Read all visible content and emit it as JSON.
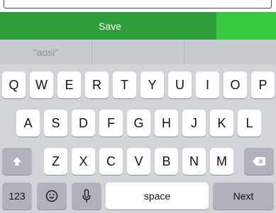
{
  "form": {
    "save_label": "Save"
  },
  "keyboard": {
    "suggestions": [
      "“aosi”",
      "",
      ""
    ],
    "row1": [
      "Q",
      "W",
      "E",
      "R",
      "T",
      "Y",
      "U",
      "I",
      "O",
      "P"
    ],
    "row2": [
      "A",
      "S",
      "D",
      "F",
      "G",
      "H",
      "J",
      "K",
      "L"
    ],
    "row3": [
      "Z",
      "X",
      "C",
      "V",
      "B",
      "N",
      "M"
    ],
    "numbers_label": "123",
    "space_label": "space",
    "next_label": "Next"
  },
  "colors": {
    "save_bar": "#2e9e3a",
    "save_bar_accent": "#37c93e",
    "keyboard_bg": "#d1d4d9"
  },
  "icons": {
    "shift": "shift-icon",
    "delete": "backspace-icon",
    "emoji": "emoji-icon",
    "microphone": "microphone-icon"
  }
}
